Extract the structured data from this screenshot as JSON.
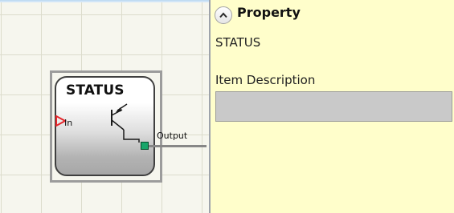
{
  "canvas": {
    "block": {
      "title": "STATUS",
      "input_label": "In",
      "output_label": "Output"
    }
  },
  "property_panel": {
    "header": "Property",
    "item_name": "STATUS",
    "description_label": "Item Description",
    "description_value": ""
  },
  "colors": {
    "panel_background": "#fffecb",
    "input_arrow": "#e5262b",
    "output_pin": "#18a66a",
    "canvas_background": "#f6f6ee"
  },
  "icons": {
    "collapse": "chevron-up-icon",
    "input": "triangle-arrow-icon",
    "symbol": "transistor-icon"
  }
}
